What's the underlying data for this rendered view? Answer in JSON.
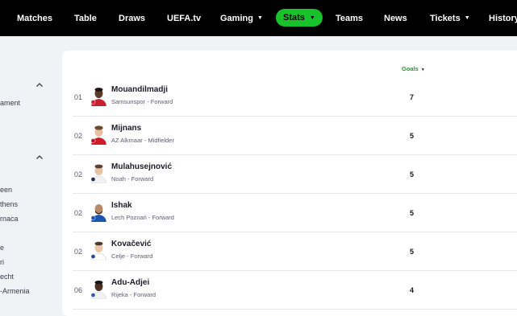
{
  "nav": {
    "items": [
      {
        "label": "Matches"
      },
      {
        "label": "Table"
      },
      {
        "label": "Draws"
      },
      {
        "label": "UEFA.tv"
      },
      {
        "label": "Gaming",
        "caret": "▼"
      },
      {
        "label": "Stats",
        "caret": "▼",
        "active": true
      },
      {
        "label": "Teams"
      },
      {
        "label": "News"
      },
      {
        "label": "Tickets",
        "caret": "▼"
      },
      {
        "label": "History"
      }
    ]
  },
  "sidebar": {
    "items": [
      "ament",
      "een",
      "thens",
      "rnaca",
      "e",
      "ri",
      "echt",
      "-Armenia"
    ]
  },
  "table": {
    "goals_header": "Goals",
    "sort_icon": "▼",
    "rows": [
      {
        "rank": "01",
        "name": "Mouandilmadji",
        "club": "Samsunspor",
        "position": "Forward",
        "goals": "7"
      },
      {
        "rank": "02",
        "name": "Mijnans",
        "club": "AZ Alkmaar",
        "position": "Midfielder",
        "goals": "5"
      },
      {
        "rank": "02",
        "name": "Mulahusejnović",
        "club": "Noah",
        "position": "Forward",
        "goals": "5"
      },
      {
        "rank": "02",
        "name": "Ishak",
        "club": "Lech Poznań",
        "position": "Forward",
        "goals": "5"
      },
      {
        "rank": "02",
        "name": "Kovačević",
        "club": "Celje",
        "position": "Forward",
        "goals": "5"
      },
      {
        "rank": "06",
        "name": "Adu-Adjei",
        "club": "Rijeka",
        "position": "Forward",
        "goals": "4"
      }
    ]
  },
  "colors": {
    "accent": "#18c22a",
    "nav_bg": "#000000",
    "page_bg": "#f1f2f5"
  }
}
